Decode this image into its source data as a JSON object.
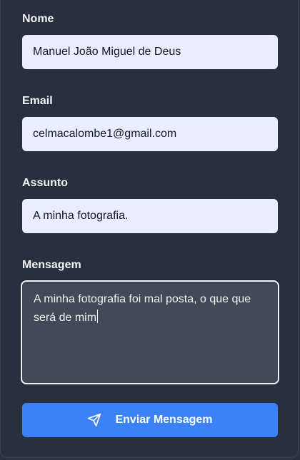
{
  "form": {
    "name": {
      "label": "Nome",
      "value": "Manuel João Miguel de Deus"
    },
    "email": {
      "label": "Email",
      "value": "celmacalombe1@gmail.com"
    },
    "subject": {
      "label": "Assunto",
      "value": "A minha fotografia."
    },
    "message": {
      "label": "Mensagem",
      "value": "A minha fotografia foi mal posta, o que que será de mim"
    },
    "submit": {
      "label": "Enviar Mensagem",
      "icon": "send-icon"
    }
  },
  "colors": {
    "background": "#283040",
    "input_bg": "#e8eefe",
    "textarea_bg": "#434a57",
    "accent": "#3b82f6"
  }
}
